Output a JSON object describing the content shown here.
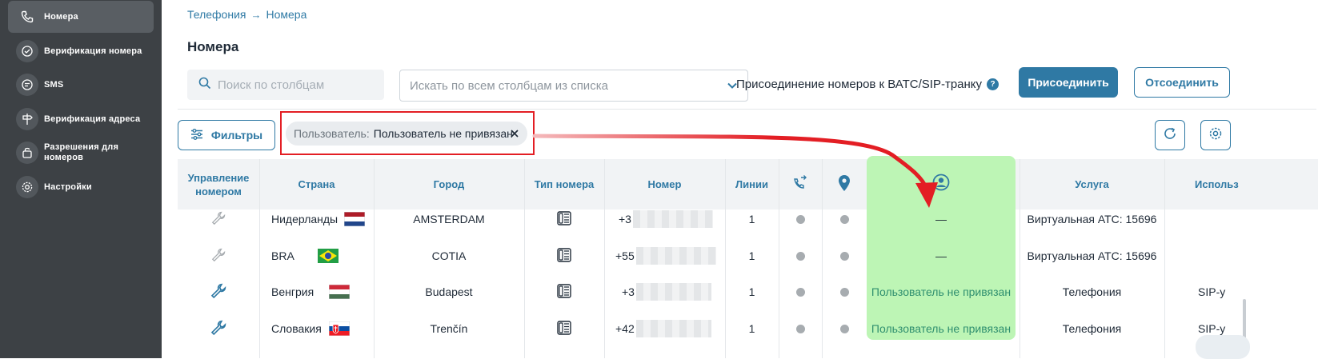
{
  "sidebar": {
    "items": [
      {
        "label": "Номера",
        "icon": "phone-icon",
        "active": true
      },
      {
        "label": "Верификация номера",
        "icon": "phone-check-icon"
      },
      {
        "label": "SMS",
        "icon": "sms-icon"
      },
      {
        "label": "Верификация адреса",
        "icon": "signpost-icon"
      },
      {
        "label": "Разрешения для номеров",
        "icon": "permissions-icon"
      },
      {
        "label": "Настройки",
        "icon": "gear-icon"
      }
    ]
  },
  "breadcrumb": {
    "root": "Телефония",
    "separator": "→",
    "current": "Номера"
  },
  "page_title": "Номера",
  "toolbar": {
    "column_search_placeholder": "Поиск по столбцам",
    "all_search_placeholder": "Искать по всем столбцам из списка",
    "attach_label": "Присоединение номеров к ВАТС/SIP-транку",
    "help_glyph": "?",
    "attach_button": "Присоединить",
    "detach_button": "Отсоединить"
  },
  "filters": {
    "button_label": "Фильтры",
    "chip_key": "Пользователь:",
    "chip_value": "Пользователь не привязан"
  },
  "table": {
    "headers": {
      "manage": "Управление номером",
      "country": "Страна",
      "city": "Город",
      "type": "Тип номера",
      "number": "Номер",
      "lines": "Линии",
      "service": "Услуга",
      "used": "Использ"
    },
    "rows": [
      {
        "country": "Нидерланды",
        "flag": "nl",
        "city": "AMSTERDAM",
        "number_prefix": "+3",
        "lines": "1",
        "user": "—",
        "service": "Виртуальная АТС: 15696",
        "used": "",
        "manage_enabled": false
      },
      {
        "country": "BRA",
        "flag": "br",
        "city": "COTIA",
        "number_prefix": "+55",
        "lines": "1",
        "user": "—",
        "service": "Виртуальная АТС: 15696",
        "used": "",
        "manage_enabled": false
      },
      {
        "country": "Венгрия",
        "flag": "hu",
        "city": "Budapest",
        "number_prefix": "+3",
        "lines": "1",
        "user": "Пользователь не привязан",
        "service": "Телефония",
        "used": "SIP-у",
        "manage_enabled": true
      },
      {
        "country": "Словакия",
        "flag": "sk",
        "city": "Trenčín",
        "number_prefix": "+42",
        "lines": "1",
        "user": "Пользователь не привязан",
        "service": "Телефония",
        "used": "SIP-у",
        "manage_enabled": true
      }
    ]
  },
  "colors": {
    "accent": "#2f79a4",
    "highlight": "#bdf5b5",
    "annotation": "#e31e24",
    "sidebar": "#3d4145"
  }
}
